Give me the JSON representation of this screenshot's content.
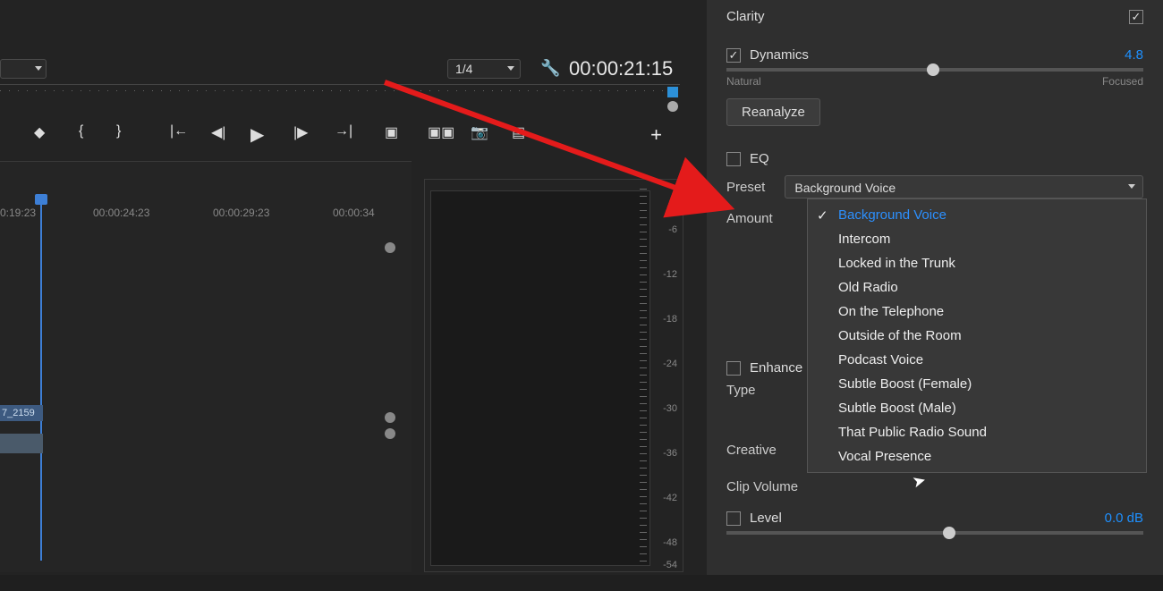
{
  "program": {
    "zoom": "1/4",
    "timecode": "00:00:21:15"
  },
  "timeline": {
    "head_timecode": "0:19:23",
    "ticks": [
      "00:00:24:23",
      "00:00:29:23",
      "00:00:34"
    ],
    "clip_label": "7_2159"
  },
  "meter": {
    "labels": [
      "-6",
      "-12",
      "-18",
      "-24",
      "-30",
      "-36",
      "-42",
      "-48",
      "-54"
    ]
  },
  "panel": {
    "clarity_label": "Clarity",
    "dynamics_label": "Dynamics",
    "dynamics_value": "4.8",
    "slider_left": "Natural",
    "slider_right": "Focused",
    "reanalyze": "Reanalyze",
    "eq_label": "EQ",
    "preset_label": "Preset",
    "preset_selected": "Background Voice",
    "preset_options": [
      "Background Voice",
      "Intercom",
      "Locked in the Trunk",
      "Old Radio",
      "On the Telephone",
      "Outside of the Room",
      "Podcast Voice",
      "Subtle Boost (Female)",
      "Subtle Boost (Male)",
      "That Public Radio Sound",
      "Vocal Presence"
    ],
    "amount_label": "Amount",
    "enhance_label": "Enhance",
    "type_label": "Type",
    "creative_label": "Creative",
    "clip_volume_label": "Clip Volume",
    "level_label": "Level",
    "level_value": "0.0 dB"
  }
}
